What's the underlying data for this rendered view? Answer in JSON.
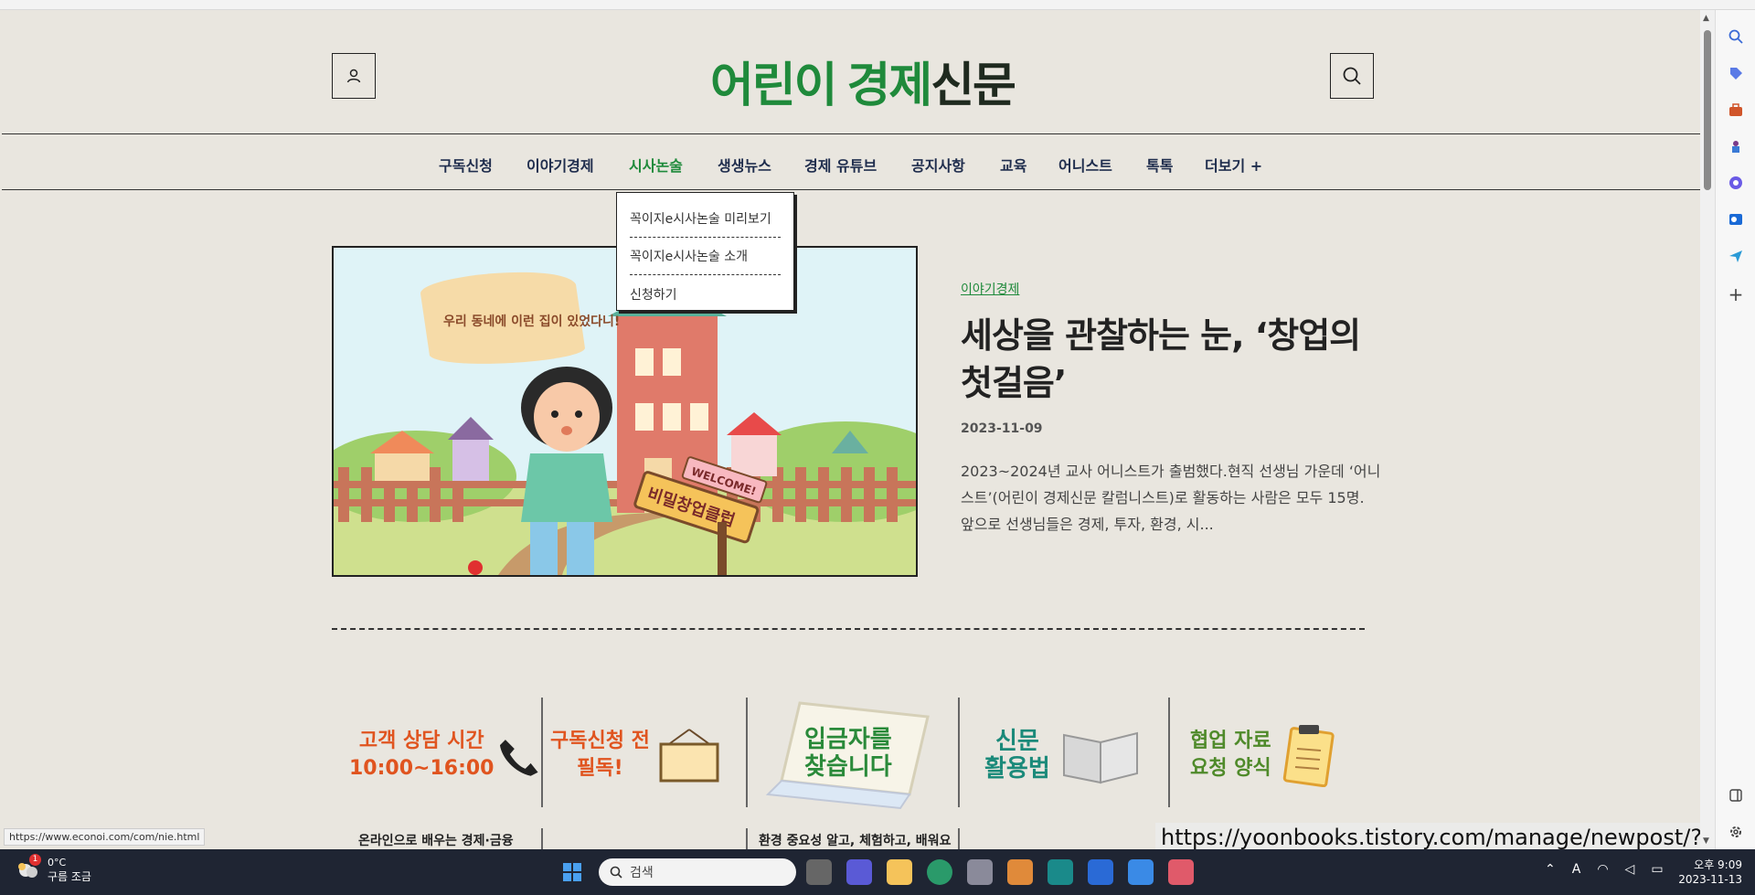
{
  "header": {
    "logo_part1": "어린이",
    "logo_part2": "경제",
    "logo_part3": "신문"
  },
  "nav": {
    "items": [
      "구독신청",
      "이야기경제",
      "시사논술",
      "생생뉴스",
      "경제 유튜브",
      "공지사항",
      "교육",
      "어니스트",
      "톡톡",
      "더보기 +"
    ],
    "active_index": 2
  },
  "dropdown": {
    "items": [
      "꼭이지e시사논술 미리보기",
      "꼭이지e시사논술 소개",
      "신청하기"
    ]
  },
  "feature": {
    "category": "이야기경제",
    "title": "세상을 관찰하는 눈, ‘창업의 첫걸음’",
    "date": "2023-11-09",
    "excerpt": "2023~2024년 교사 어니스트가 출범했다.현직 선생님 가운데 ‘어니스트’(어린이 경제신문 칼럼니스트)로 활동하는 사람은 모두 15명. 앞으로 선생님들은 경제, 투자, 환경, 시...",
    "image_speech": "우리 동네에 이런 집이 있었다니!",
    "image_sign": "비밀창업클럽",
    "image_welcome": "WELCOME!"
  },
  "banners": {
    "b1_line1": "고객 상담 시간",
    "b1_line2": "10:00~16:00",
    "b2_line1": "구독신청 전",
    "b2_line2": "필독!",
    "b3_line1": "입금자를",
    "b3_line2": "찾습니다",
    "b4_line1": "신문",
    "b4_line2": "활용법",
    "b5_line1": "협업 자료",
    "b5_line2": "요청 양식"
  },
  "lower": {
    "left_text": "온라인으로 배우는 경제·금융",
    "mid_text": "환경 중요성 알고, 체험하고, 배워요"
  },
  "status": {
    "hover_url": "https://www.econoi.com/com/nie.html",
    "tooltip_url": "https://yoonbooks.tistory.com/manage/newpost/?type"
  },
  "taskbar": {
    "weather_badge": "1",
    "temp": "0°C",
    "weather_desc": "구름 조금",
    "search_placeholder": "검색",
    "time": "오후 9:09",
    "date": "2023-11-13"
  },
  "colors": {
    "brand_green": "#1f8a3b",
    "nav_text": "#1f2d4d",
    "page_bg": "#e9e6df",
    "banner_orange": "#e0541f",
    "banner_teal": "#1b8a7a",
    "banner_olive": "#4f8a2a"
  }
}
